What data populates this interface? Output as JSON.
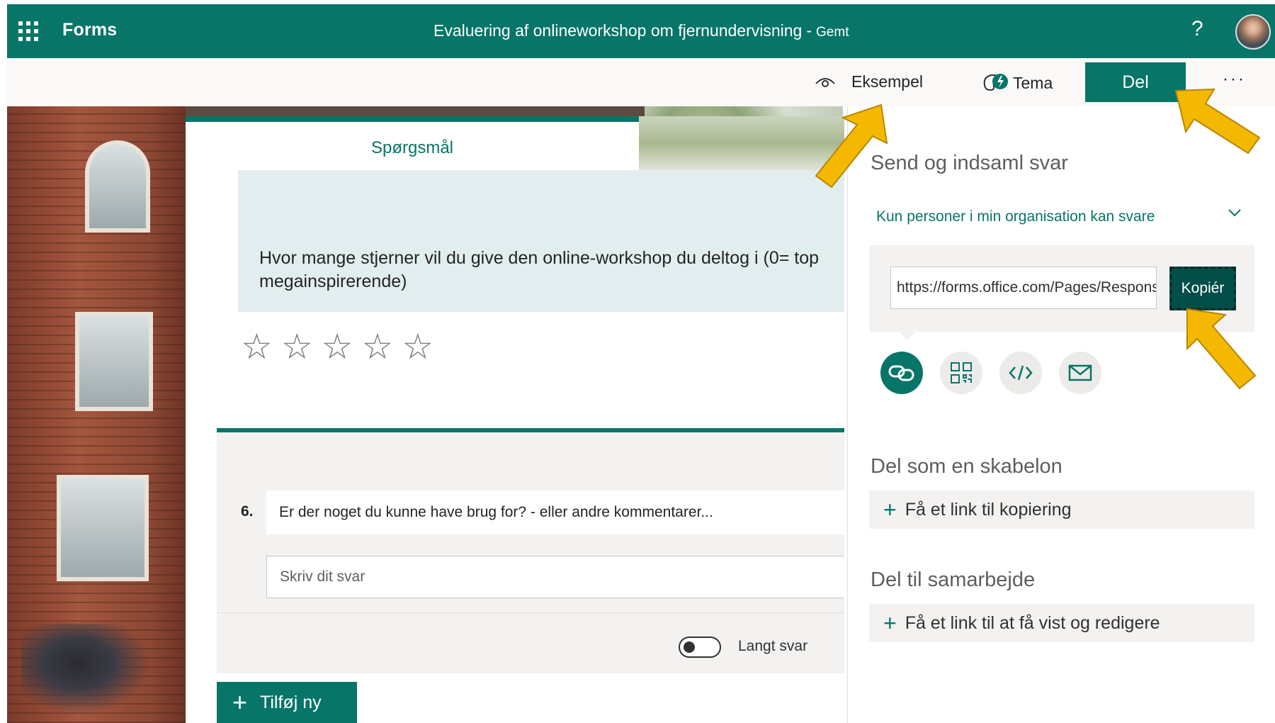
{
  "app": {
    "name": "Forms",
    "form_title": "Evaluering af onlineworkshop om fjernundervisning",
    "separator": "-",
    "save_status": "Gemt",
    "help_label": "?"
  },
  "commandbar": {
    "preview_label": "Eksempel",
    "theme_label": "Tema",
    "share_label": "Del",
    "more_label": "···"
  },
  "form": {
    "tab_label": "Spørgsmål",
    "q5_text_line1": "Hvor mange stjerner vil du give den online-workshop du deltog i (0= top",
    "q5_text_line2": "megainspirerende)",
    "rating": {
      "filled": 0,
      "max": 5,
      "star_glyph": "☆"
    },
    "q6_number": "6.",
    "q6_text": "Er der noget du kunne have brug for? - eller andre kommentarer...",
    "q6_placeholder": "Skriv dit svar",
    "long_answer_label": "Langt svar",
    "long_answer_on": false,
    "add_new_label": "Tilføj ny",
    "plus_glyph": "+"
  },
  "share_panel": {
    "title": "Send og indsaml svar",
    "permission": "Kun personer i min organisation kan svare",
    "url": "https://forms.office.com/Pages/ResponsePage.aspx",
    "copy_label": "Kopiér",
    "icons": [
      "link-icon",
      "qr-code-icon",
      "embed-icon",
      "email-icon"
    ],
    "template_heading": "Del som en skabelon",
    "template_link": "Få et link til kopiering",
    "collab_heading": "Del til samarbejde",
    "collab_link": "Få et link til at få vist og redigere"
  },
  "colors": {
    "brand": "#077568",
    "brand_dark": "#004e47",
    "arrow": "#f5b800"
  }
}
